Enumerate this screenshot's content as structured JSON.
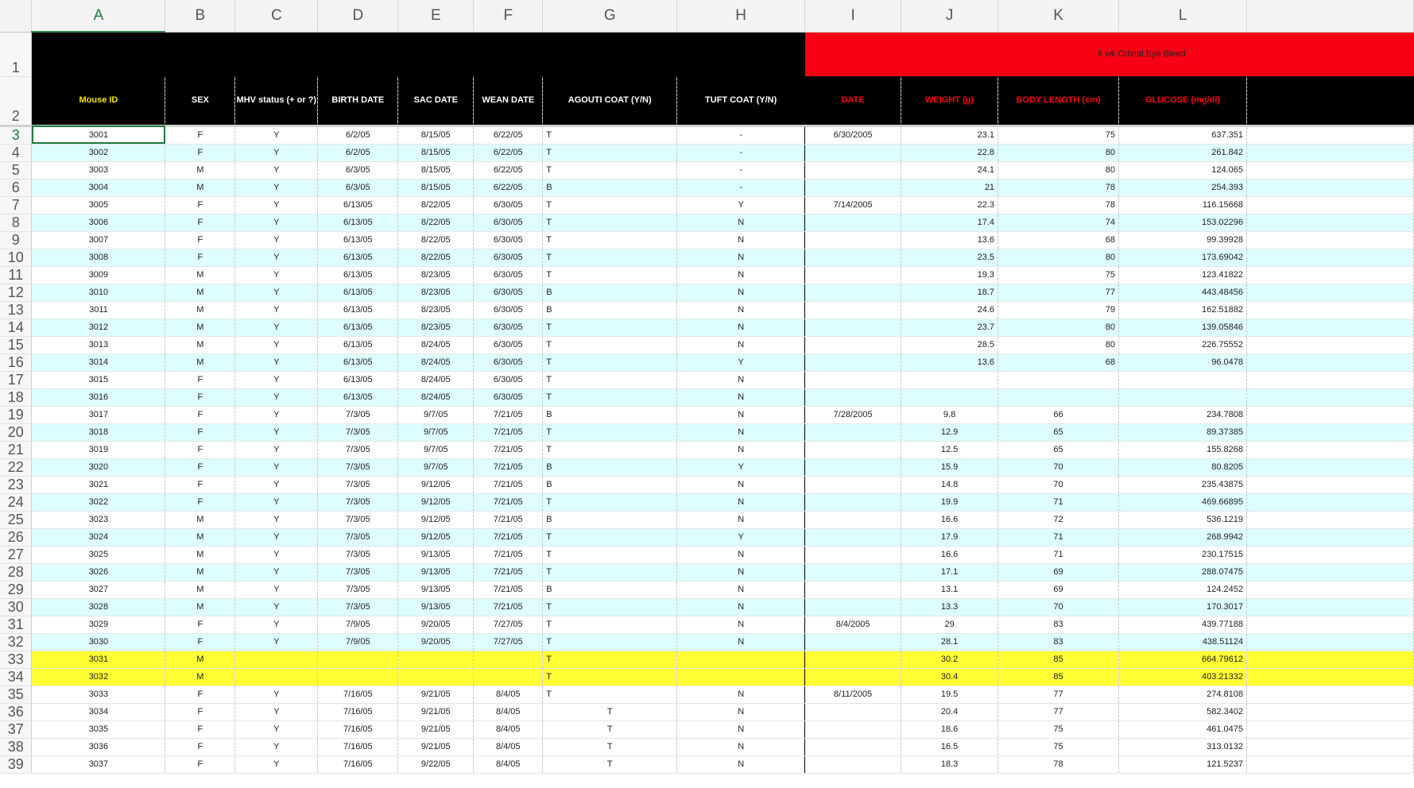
{
  "columns": [
    "A",
    "B",
    "C",
    "D",
    "E",
    "F",
    "G",
    "H",
    "I",
    "J",
    "K",
    "L"
  ],
  "active_column": "A",
  "header_row1": {
    "bleed_label": "4 wk Orbital Eye Bleed"
  },
  "header_row2": {
    "mouse_id": "Mouse ID",
    "sex": "SEX",
    "mhv": "MHV status (+ or ?)",
    "birth": "BIRTH DATE",
    "sac": "SAC DATE",
    "wean": "WEAN DATE",
    "agouti": "AGOUTI COAT (Y/N)",
    "tuft": "TUFT COAT (Y/N)",
    "date": "DATE",
    "weight": "WEIGHT (g)",
    "length": "BODY LENGTH (cm)",
    "glucose": "GLUCOSE (mg/dl)"
  },
  "row_numbers": [
    "1",
    "2",
    "3",
    "4",
    "5",
    "6",
    "7",
    "8",
    "9",
    "10",
    "11",
    "12",
    "13",
    "14",
    "15",
    "16",
    "17",
    "18",
    "19",
    "20",
    "21",
    "22",
    "23",
    "24",
    "25",
    "26",
    "27",
    "28",
    "29",
    "30",
    "31",
    "32",
    "33",
    "34",
    "35",
    "36",
    "37",
    "38",
    "39"
  ],
  "rows": [
    {
      "num": "3",
      "style": "white",
      "id": "3001",
      "sex": "F",
      "mhv": "Y",
      "birth": "6/2/05",
      "sac": "8/15/05",
      "wean": "6/22/05",
      "agouti": "T",
      "agouti_align": "left",
      "tuft": "-",
      "date": "6/30/2005",
      "weight": "23.1",
      "length": "75",
      "glucose": "637.351",
      "wl_align": "right"
    },
    {
      "num": "4",
      "style": "cyan",
      "id": "3002",
      "sex": "F",
      "mhv": "Y",
      "birth": "6/2/05",
      "sac": "8/15/05",
      "wean": "6/22/05",
      "agouti": "T",
      "agouti_align": "left",
      "tuft": "-",
      "date": "",
      "weight": "22.8",
      "length": "80",
      "glucose": "261.842",
      "wl_align": "right"
    },
    {
      "num": "5",
      "style": "white",
      "id": "3003",
      "sex": "M",
      "mhv": "Y",
      "birth": "6/3/05",
      "sac": "8/15/05",
      "wean": "6/22/05",
      "agouti": "T",
      "agouti_align": "left",
      "tuft": "-",
      "date": "",
      "weight": "24.1",
      "length": "80",
      "glucose": "124.065",
      "wl_align": "right"
    },
    {
      "num": "6",
      "style": "cyan",
      "id": "3004",
      "sex": "M",
      "mhv": "Y",
      "birth": "6/3/05",
      "sac": "8/15/05",
      "wean": "6/22/05",
      "agouti": "B",
      "agouti_align": "left",
      "tuft": "-",
      "date": "",
      "weight": "21",
      "length": "78",
      "glucose": "254.393",
      "wl_align": "right"
    },
    {
      "num": "7",
      "style": "white",
      "id": "3005",
      "sex": "F",
      "mhv": "Y",
      "birth": "6/13/05",
      "sac": "8/22/05",
      "wean": "6/30/05",
      "agouti": "T",
      "agouti_align": "left",
      "tuft": "Y",
      "date": "7/14/2005",
      "weight": "22.3",
      "length": "78",
      "glucose": "116.15668",
      "wl_align": "right"
    },
    {
      "num": "8",
      "style": "cyan",
      "id": "3006",
      "sex": "F",
      "mhv": "Y",
      "birth": "6/13/05",
      "sac": "8/22/05",
      "wean": "6/30/05",
      "agouti": "T",
      "agouti_align": "left",
      "tuft": "N",
      "date": "",
      "weight": "17.4",
      "length": "74",
      "glucose": "153.02296",
      "wl_align": "right"
    },
    {
      "num": "9",
      "style": "white",
      "id": "3007",
      "sex": "F",
      "mhv": "Y",
      "birth": "6/13/05",
      "sac": "8/22/05",
      "wean": "6/30/05",
      "agouti": "T",
      "agouti_align": "left",
      "tuft": "N",
      "date": "",
      "weight": "13.6",
      "length": "68",
      "glucose": "99.39928",
      "wl_align": "right"
    },
    {
      "num": "10",
      "style": "cyan",
      "id": "3008",
      "sex": "F",
      "mhv": "Y",
      "birth": "6/13/05",
      "sac": "8/22/05",
      "wean": "6/30/05",
      "agouti": "T",
      "agouti_align": "left",
      "tuft": "N",
      "date": "",
      "weight": "23.5",
      "length": "80",
      "glucose": "173.69042",
      "wl_align": "right"
    },
    {
      "num": "11",
      "style": "white",
      "id": "3009",
      "sex": "M",
      "mhv": "Y",
      "birth": "6/13/05",
      "sac": "8/23/05",
      "wean": "6/30/05",
      "agouti": "T",
      "agouti_align": "left",
      "tuft": "N",
      "date": "",
      "weight": "19.3",
      "length": "75",
      "glucose": "123.41822",
      "wl_align": "right"
    },
    {
      "num": "12",
      "style": "cyan",
      "id": "3010",
      "sex": "M",
      "mhv": "Y",
      "birth": "6/13/05",
      "sac": "8/23/05",
      "wean": "6/30/05",
      "agouti": "B",
      "agouti_align": "left",
      "tuft": "N",
      "date": "",
      "weight": "18.7",
      "length": "77",
      "glucose": "443.48456",
      "wl_align": "right"
    },
    {
      "num": "13",
      "style": "white",
      "id": "3011",
      "sex": "M",
      "mhv": "Y",
      "birth": "6/13/05",
      "sac": "8/23/05",
      "wean": "6/30/05",
      "agouti": "B",
      "agouti_align": "left",
      "tuft": "N",
      "date": "",
      "weight": "24.6",
      "length": "79",
      "glucose": "162.51882",
      "wl_align": "right"
    },
    {
      "num": "14",
      "style": "cyan",
      "id": "3012",
      "sex": "M",
      "mhv": "Y",
      "birth": "6/13/05",
      "sac": "8/23/05",
      "wean": "6/30/05",
      "agouti": "T",
      "agouti_align": "left",
      "tuft": "N",
      "date": "",
      "weight": "23.7",
      "length": "80",
      "glucose": "139.05846",
      "wl_align": "right"
    },
    {
      "num": "15",
      "style": "white",
      "id": "3013",
      "sex": "M",
      "mhv": "Y",
      "birth": "6/13/05",
      "sac": "8/24/05",
      "wean": "6/30/05",
      "agouti": "T",
      "agouti_align": "left",
      "tuft": "N",
      "date": "",
      "weight": "28.5",
      "length": "80",
      "glucose": "226.75552",
      "wl_align": "right"
    },
    {
      "num": "16",
      "style": "cyan",
      "id": "3014",
      "sex": "M",
      "mhv": "Y",
      "birth": "6/13/05",
      "sac": "8/24/05",
      "wean": "6/30/05",
      "agouti": "T",
      "agouti_align": "left",
      "tuft": "Y",
      "date": "",
      "weight": "13.6",
      "length": "68",
      "glucose": "96.0478",
      "wl_align": "right"
    },
    {
      "num": "17",
      "style": "white",
      "id": "3015",
      "sex": "F",
      "mhv": "Y",
      "birth": "6/13/05",
      "sac": "8/24/05",
      "wean": "6/30/05",
      "agouti": "T",
      "agouti_align": "left",
      "tuft": "N",
      "date": "",
      "weight": "",
      "length": "",
      "glucose": "",
      "wl_align": "right"
    },
    {
      "num": "18",
      "style": "cyan",
      "id": "3016",
      "sex": "F",
      "mhv": "Y",
      "birth": "6/13/05",
      "sac": "8/24/05",
      "wean": "6/30/05",
      "agouti": "T",
      "agouti_align": "left",
      "tuft": "N",
      "date": "",
      "weight": "",
      "length": "",
      "glucose": "",
      "wl_align": "right"
    },
    {
      "num": "19",
      "style": "white",
      "id": "3017",
      "sex": "F",
      "mhv": "Y",
      "birth": "7/3/05",
      "sac": "9/7/05",
      "wean": "7/21/05",
      "agouti": "B",
      "agouti_align": "left",
      "tuft": "N",
      "date": "7/28/2005",
      "weight": "9.8",
      "length": "66",
      "glucose": "234.7808",
      "wl_align": "center"
    },
    {
      "num": "20",
      "style": "cyan",
      "id": "3018",
      "sex": "F",
      "mhv": "Y",
      "birth": "7/3/05",
      "sac": "9/7/05",
      "wean": "7/21/05",
      "agouti": "T",
      "agouti_align": "left",
      "tuft": "N",
      "date": "",
      "weight": "12.9",
      "length": "65",
      "glucose": "89.37385",
      "wl_align": "center"
    },
    {
      "num": "21",
      "style": "white",
      "id": "3019",
      "sex": "F",
      "mhv": "Y",
      "birth": "7/3/05",
      "sac": "9/7/05",
      "wean": "7/21/05",
      "agouti": "T",
      "agouti_align": "left",
      "tuft": "N",
      "date": "",
      "weight": "12.5",
      "length": "65",
      "glucose": "155.8268",
      "wl_align": "center"
    },
    {
      "num": "22",
      "style": "cyan",
      "id": "3020",
      "sex": "F",
      "mhv": "Y",
      "birth": "7/3/05",
      "sac": "9/7/05",
      "wean": "7/21/05",
      "agouti": "B",
      "agouti_align": "left",
      "tuft": "Y",
      "date": "",
      "weight": "15.9",
      "length": "70",
      "glucose": "80.8205",
      "wl_align": "center"
    },
    {
      "num": "23",
      "style": "white",
      "id": "3021",
      "sex": "F",
      "mhv": "Y",
      "birth": "7/3/05",
      "sac": "9/12/05",
      "wean": "7/21/05",
      "agouti": "B",
      "agouti_align": "left",
      "tuft": "N",
      "date": "",
      "weight": "14.8",
      "length": "70",
      "glucose": "235.43875",
      "wl_align": "center"
    },
    {
      "num": "24",
      "style": "cyan",
      "id": "3022",
      "sex": "F",
      "mhv": "Y",
      "birth": "7/3/05",
      "sac": "9/12/05",
      "wean": "7/21/05",
      "agouti": "T",
      "agouti_align": "left",
      "tuft": "N",
      "date": "",
      "weight": "19.9",
      "length": "71",
      "glucose": "469.66895",
      "wl_align": "center"
    },
    {
      "num": "25",
      "style": "white",
      "id": "3023",
      "sex": "M",
      "mhv": "Y",
      "birth": "7/3/05",
      "sac": "9/12/05",
      "wean": "7/21/05",
      "agouti": "B",
      "agouti_align": "left",
      "tuft": "N",
      "date": "",
      "weight": "16.6",
      "length": "72",
      "glucose": "536.1219",
      "wl_align": "center"
    },
    {
      "num": "26",
      "style": "cyan",
      "id": "3024",
      "sex": "M",
      "mhv": "Y",
      "birth": "7/3/05",
      "sac": "9/12/05",
      "wean": "7/21/05",
      "agouti": "T",
      "agouti_align": "left",
      "tuft": "Y",
      "date": "",
      "weight": "17.9",
      "length": "71",
      "glucose": "268.9942",
      "wl_align": "center"
    },
    {
      "num": "27",
      "style": "white",
      "id": "3025",
      "sex": "M",
      "mhv": "Y",
      "birth": "7/3/05",
      "sac": "9/13/05",
      "wean": "7/21/05",
      "agouti": "T",
      "agouti_align": "left",
      "tuft": "N",
      "date": "",
      "weight": "16.6",
      "length": "71",
      "glucose": "230.17515",
      "wl_align": "center"
    },
    {
      "num": "28",
      "style": "cyan",
      "id": "3026",
      "sex": "M",
      "mhv": "Y",
      "birth": "7/3/05",
      "sac": "9/13/05",
      "wean": "7/21/05",
      "agouti": "T",
      "agouti_align": "left",
      "tuft": "N",
      "date": "",
      "weight": "17.1",
      "length": "69",
      "glucose": "288.07475",
      "wl_align": "center"
    },
    {
      "num": "29",
      "style": "white",
      "id": "3027",
      "sex": "M",
      "mhv": "Y",
      "birth": "7/3/05",
      "sac": "9/13/05",
      "wean": "7/21/05",
      "agouti": "B",
      "agouti_align": "left",
      "tuft": "N",
      "date": "",
      "weight": "13.1",
      "length": "69",
      "glucose": "124.2452",
      "wl_align": "center"
    },
    {
      "num": "30",
      "style": "cyan",
      "id": "3028",
      "sex": "M",
      "mhv": "Y",
      "birth": "7/3/05",
      "sac": "9/13/05",
      "wean": "7/21/05",
      "agouti": "T",
      "agouti_align": "left",
      "tuft": "N",
      "date": "",
      "weight": "13.3",
      "length": "70",
      "glucose": "170.3017",
      "wl_align": "center"
    },
    {
      "num": "31",
      "style": "white",
      "id": "3029",
      "sex": "F",
      "mhv": "Y",
      "birth": "7/9/05",
      "sac": "9/20/05",
      "wean": "7/27/05",
      "agouti": "T",
      "agouti_align": "left",
      "tuft": "N",
      "date": "8/4/2005",
      "weight": "29",
      "length": "83",
      "glucose": "439.77188",
      "wl_align": "center"
    },
    {
      "num": "32",
      "style": "cyan",
      "id": "3030",
      "sex": "F",
      "mhv": "Y",
      "birth": "7/9/05",
      "sac": "9/20/05",
      "wean": "7/27/05",
      "agouti": "T",
      "agouti_align": "left",
      "tuft": "N",
      "date": "",
      "weight": "28.1",
      "length": "83",
      "glucose": "438.51124",
      "wl_align": "center"
    },
    {
      "num": "33",
      "style": "yellow",
      "id": "3031",
      "sex": "M",
      "mhv": "",
      "birth": "",
      "sac": "",
      "wean": "",
      "agouti": "T",
      "agouti_align": "left",
      "tuft": "",
      "date": "",
      "weight": "30.2",
      "length": "85",
      "glucose": "664.79612",
      "wl_align": "center"
    },
    {
      "num": "34",
      "style": "yellow",
      "id": "3032",
      "sex": "M",
      "mhv": "",
      "birth": "",
      "sac": "",
      "wean": "",
      "agouti": "T",
      "agouti_align": "left",
      "tuft": "",
      "date": "",
      "weight": "30.4",
      "length": "85",
      "glucose": "403.21332",
      "wl_align": "center"
    },
    {
      "num": "35",
      "style": "white",
      "id": "3033",
      "sex": "F",
      "mhv": "Y",
      "birth": "7/16/05",
      "sac": "9/21/05",
      "wean": "8/4/05",
      "agouti": "T",
      "agouti_align": "left",
      "tuft": "N",
      "date": "8/11/2005",
      "weight": "19.5",
      "length": "77",
      "glucose": "274.8108",
      "wl_align": "center"
    },
    {
      "num": "36",
      "style": "white",
      "id": "3034",
      "sex": "F",
      "mhv": "Y",
      "birth": "7/16/05",
      "sac": "9/21/05",
      "wean": "8/4/05",
      "agouti": "T",
      "agouti_align": "center",
      "tuft": "N",
      "date": "",
      "weight": "20.4",
      "length": "77",
      "glucose": "582.3402",
      "wl_align": "center"
    },
    {
      "num": "37",
      "style": "white",
      "id": "3035",
      "sex": "F",
      "mhv": "Y",
      "birth": "7/16/05",
      "sac": "9/21/05",
      "wean": "8/4/05",
      "agouti": "T",
      "agouti_align": "center",
      "tuft": "N",
      "date": "",
      "weight": "18.6",
      "length": "75",
      "glucose": "461.0475",
      "wl_align": "center"
    },
    {
      "num": "38",
      "style": "white",
      "id": "3036",
      "sex": "F",
      "mhv": "Y",
      "birth": "7/16/05",
      "sac": "9/21/05",
      "wean": "8/4/05",
      "agouti": "T",
      "agouti_align": "center",
      "tuft": "N",
      "date": "",
      "weight": "16.5",
      "length": "75",
      "glucose": "313.0132",
      "wl_align": "center"
    },
    {
      "num": "39",
      "style": "white",
      "id": "3037",
      "sex": "F",
      "mhv": "Y",
      "birth": "7/16/05",
      "sac": "9/22/05",
      "wean": "8/4/05",
      "agouti": "T",
      "agouti_align": "center",
      "tuft": "N",
      "date": "",
      "weight": "18.3",
      "length": "78",
      "glucose": "121.5237",
      "wl_align": "center"
    }
  ],
  "colors": {
    "header_black": "#000000",
    "header_red": "#f80014",
    "mouse_id_text": "#f2e600",
    "band_cyan": "#ddfdff",
    "highlight_yellow": "#ffff33",
    "active_green": "#1f7a3d"
  }
}
